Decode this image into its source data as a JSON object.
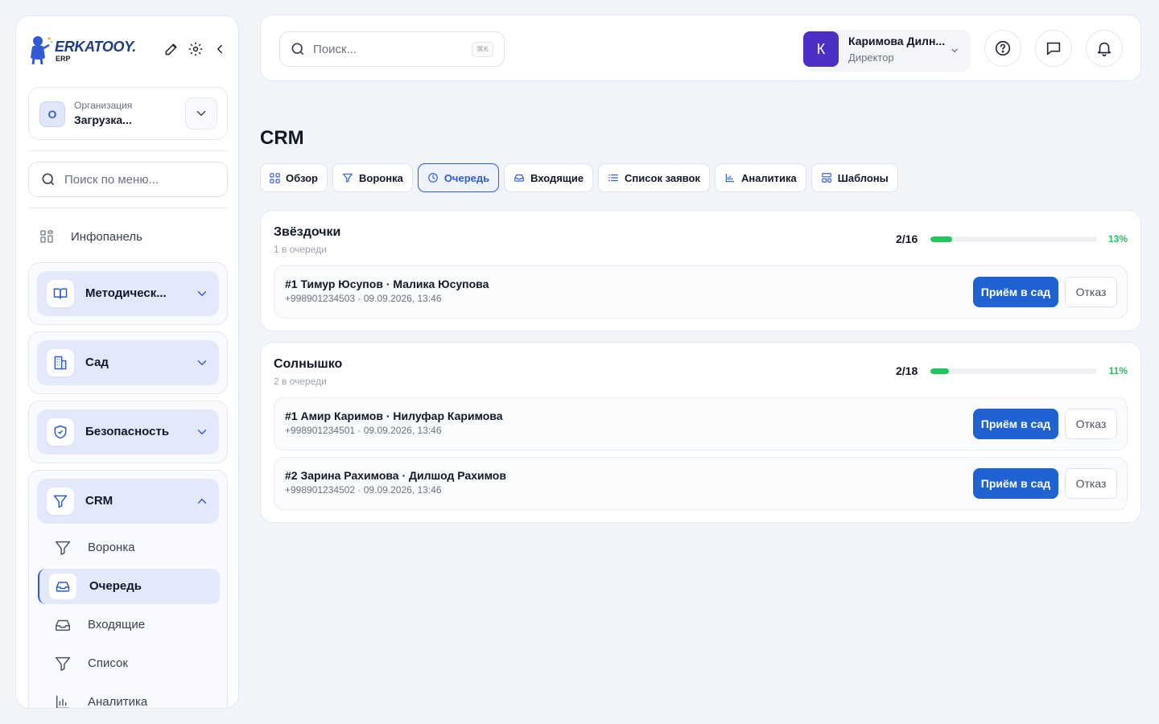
{
  "sidebar": {
    "logo_text": "ERKATOOY.",
    "logo_sub": "ERP",
    "org": {
      "avatar": "O",
      "label": "Организация",
      "value": "Загрузка..."
    },
    "search_placeholder": "Поиск по меню...",
    "dashboard_label": "Инфопанель",
    "groups": [
      {
        "label": "Методическ...",
        "icon": "book-open-icon"
      },
      {
        "label": "Сад",
        "icon": "building-icon"
      },
      {
        "label": "Безопасность",
        "icon": "shield-check-icon"
      },
      {
        "label": "CRM",
        "icon": "funnel-icon"
      }
    ],
    "crm_items": [
      {
        "label": "Воронка",
        "icon": "funnel-icon"
      },
      {
        "label": "Очередь",
        "icon": "inbox-icon",
        "active": true
      },
      {
        "label": "Входящие",
        "icon": "inbox-icon"
      },
      {
        "label": "Список",
        "icon": "funnel-icon"
      },
      {
        "label": "Аналитика",
        "icon": "bar-chart-icon"
      }
    ]
  },
  "topbar": {
    "search_placeholder": "Поиск...",
    "shortcut": "⌘K",
    "user": {
      "avatar": "К",
      "name": "Каримова Дилн...",
      "role": "Директор"
    }
  },
  "page": {
    "title": "CRM",
    "tabs": [
      {
        "label": "Обзор",
        "icon": "grid-icon"
      },
      {
        "label": "Воронка",
        "icon": "funnel-icon"
      },
      {
        "label": "Очередь",
        "icon": "clock-icon",
        "active": true
      },
      {
        "label": "Входящие",
        "icon": "inbox-icon"
      },
      {
        "label": "Список заявок",
        "icon": "list-icon"
      },
      {
        "label": "Аналитика",
        "icon": "bar-chart-icon"
      },
      {
        "label": "Шаблоны",
        "icon": "template-icon"
      }
    ]
  },
  "groups": [
    {
      "name": "Звёздочки",
      "sub": "1 в очереди",
      "count": "2/16",
      "percent_label": "13%",
      "fill": 0.13,
      "items": [
        {
          "title": "#1 Тимур Юсупов · Малика Юсупова",
          "sub": "+998901234503 · 09.09.2026, 13:46",
          "accept": "Приём в сад",
          "reject": "Отказ"
        }
      ]
    },
    {
      "name": "Солнышко",
      "sub": "2 в очереди",
      "count": "2/18",
      "percent_label": "11%",
      "fill": 0.11,
      "items": [
        {
          "title": "#1 Амир Каримов · Нилуфар Каримова",
          "sub": "+998901234501 · 09.09.2026, 13:46",
          "accept": "Приём в сад",
          "reject": "Отказ"
        },
        {
          "title": "#2 Зарина Рахимова · Дилшод Рахимов",
          "sub": "+998901234502 · 09.09.2026, 13:46",
          "accept": "Приём в сад",
          "reject": "Отказ"
        }
      ]
    }
  ],
  "colors": {
    "accent": "#1f63d3",
    "progress": "#22c55e",
    "avatar": "#4c2fc6"
  }
}
